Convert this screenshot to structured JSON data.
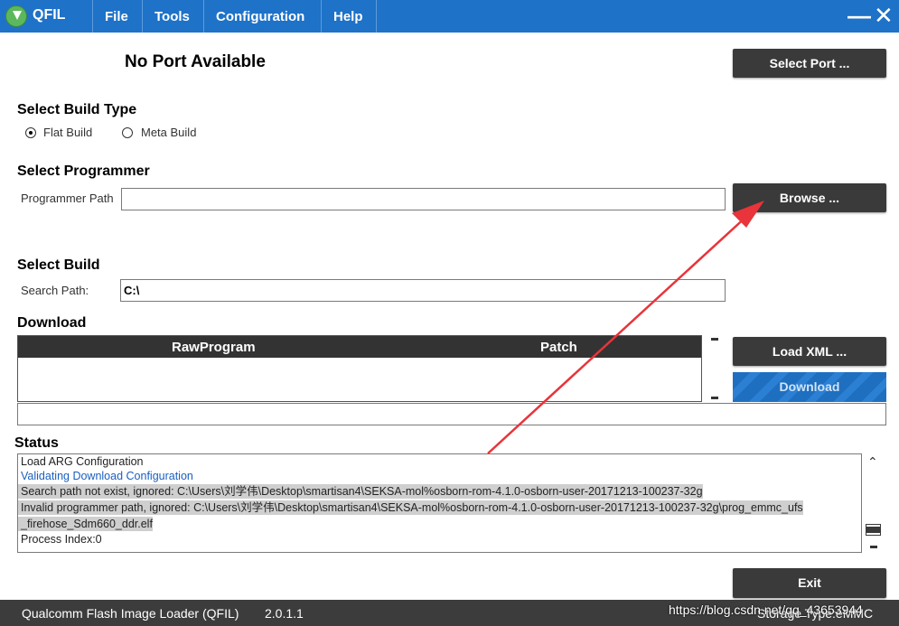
{
  "app": {
    "name": "QFIL"
  },
  "menu": [
    {
      "label": "File"
    },
    {
      "label": "Tools"
    },
    {
      "label": "Configuration"
    },
    {
      "label": "Help"
    }
  ],
  "window_controls": {
    "minimize": "—",
    "close": "✕"
  },
  "port": {
    "status": "No Port Available",
    "select_button": "Select Port ..."
  },
  "build_type": {
    "heading": "Select Build Type",
    "options": [
      {
        "label": "Flat Build",
        "selected": true
      },
      {
        "label": "Meta Build",
        "selected": false
      }
    ]
  },
  "programmer": {
    "heading": "Select Programmer",
    "path_label": "Programmer Path",
    "path_value": "",
    "browse_button": "Browse ..."
  },
  "build": {
    "heading": "Select Build",
    "search_label": "Search Path:",
    "search_value": "C:\\"
  },
  "download": {
    "heading": "Download",
    "columns": [
      "RawProgram",
      "Patch"
    ],
    "load_xml_button": "Load XML ...",
    "download_button": "Download"
  },
  "status": {
    "heading": "Status",
    "lines": [
      {
        "text": "Load ARG Configuration",
        "style": "normal"
      },
      {
        "text": "Validating Download Configuration",
        "style": "info"
      },
      {
        "text": "Search path not exist, ignored: C:\\Users\\刘学伟\\Desktop\\smartisan4\\SEKSA-mol%osborn-rom-4.1.0-osborn-user-20171213-100237-32g",
        "style": "highlight"
      },
      {
        "text": "Invalid programmer path, ignored: C:\\Users\\刘学伟\\Desktop\\smartisan4\\SEKSA-mol%osborn-rom-4.1.0-osborn-user-20171213-100237-32g\\prog_emmc_ufs",
        "style": "highlight"
      },
      {
        "text": "_firehose_Sdm660_ddr.elf",
        "style": "highlight"
      },
      {
        "text": "Process Index:0",
        "style": "normal"
      }
    ]
  },
  "exit_button": "Exit",
  "footer": {
    "app_title": "Qualcomm Flash Image Loader (QFIL)",
    "version": "2.0.1.1",
    "storage": "Storage Type:eMMC"
  },
  "watermark": "https://blog.csdn.net/qq_43653944",
  "colors": {
    "titlebar": "#1e72c8",
    "annotation_arrow": "#e8343a",
    "button_dark": "#3a3a3a"
  }
}
